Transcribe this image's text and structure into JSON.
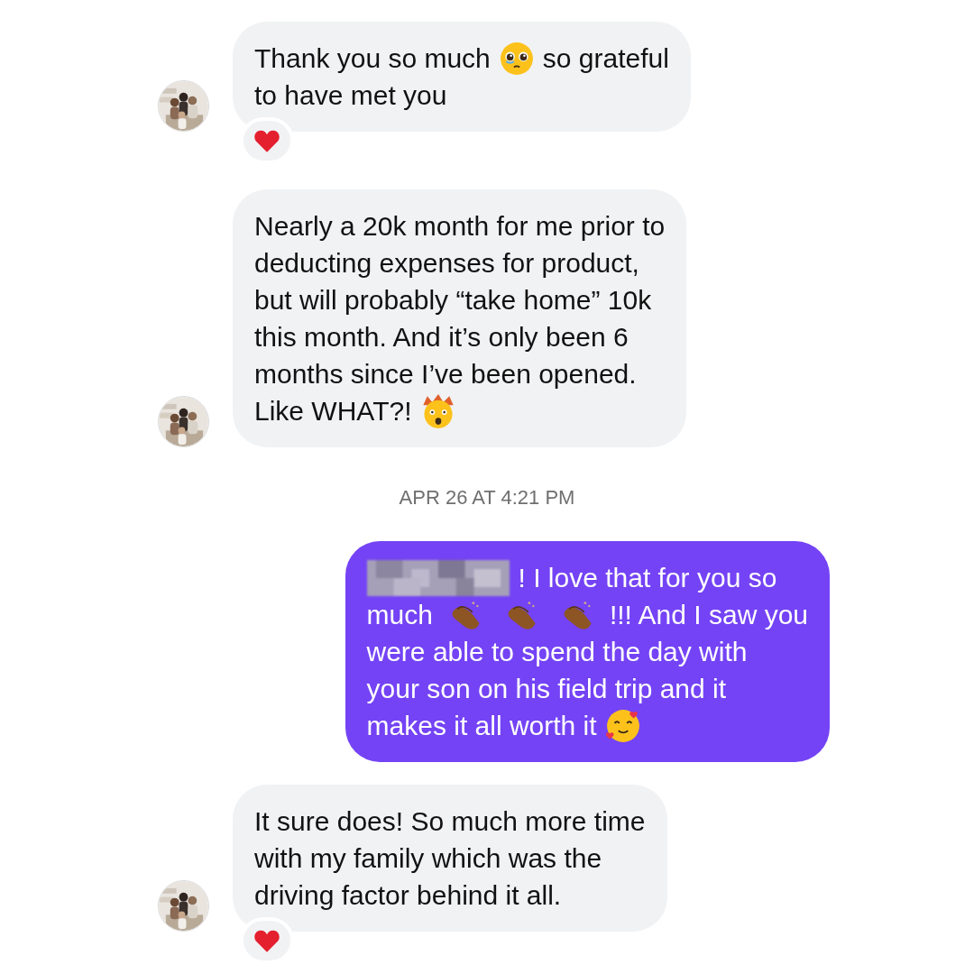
{
  "messages": [
    {
      "kind": "incoming",
      "reacted": true,
      "lines": [
        [
          {
            "kind": "text",
            "text": "Thank you so much"
          },
          {
            "kind": "pleading"
          },
          {
            "kind": "text",
            "text": "so grateful"
          }
        ],
        [
          {
            "kind": "text",
            "text": "to have met you"
          }
        ]
      ]
    },
    {
      "kind": "incoming",
      "reacted": false,
      "lines": [
        [
          {
            "kind": "text",
            "text": "Nearly a 20k month for me prior to"
          }
        ],
        [
          {
            "kind": "text",
            "text": "deducting expenses for product,"
          }
        ],
        [
          {
            "kind": "text",
            "text": "but will probably “take home” 10k"
          }
        ],
        [
          {
            "kind": "text",
            "text": "this month. And it’s only been 6"
          }
        ],
        [
          {
            "kind": "text",
            "text": "months since I’ve been opened."
          }
        ],
        [
          {
            "kind": "text",
            "text": "Like WHAT?!"
          },
          {
            "kind": "mindblown"
          }
        ]
      ]
    },
    {
      "kind": "timestamp",
      "text": "APR 26 AT 4:21 PM"
    },
    {
      "kind": "outgoing",
      "reacted": false,
      "lines": [
        [
          {
            "kind": "blur"
          },
          {
            "kind": "text",
            "text": "! I love that for you so"
          }
        ],
        [
          {
            "kind": "text",
            "text": "much"
          },
          {
            "kind": "clap"
          },
          {
            "kind": "clap"
          },
          {
            "kind": "clap"
          },
          {
            "kind": "text",
            "text": "!!! And I saw you"
          }
        ],
        [
          {
            "kind": "text",
            "text": "were able to spend the day with"
          }
        ],
        [
          {
            "kind": "text",
            "text": "your son on his field trip and it"
          }
        ],
        [
          {
            "kind": "text",
            "text": "makes it all worth it"
          },
          {
            "kind": "hearts"
          }
        ]
      ]
    },
    {
      "kind": "incoming",
      "reacted": true,
      "lines": [
        [
          {
            "kind": "text",
            "text": "It sure does! So much more time"
          }
        ],
        [
          {
            "kind": "text",
            "text": "with my family which was the"
          }
        ],
        [
          {
            "kind": "text",
            "text": "driving factor behind it all."
          }
        ]
      ]
    }
  ]
}
